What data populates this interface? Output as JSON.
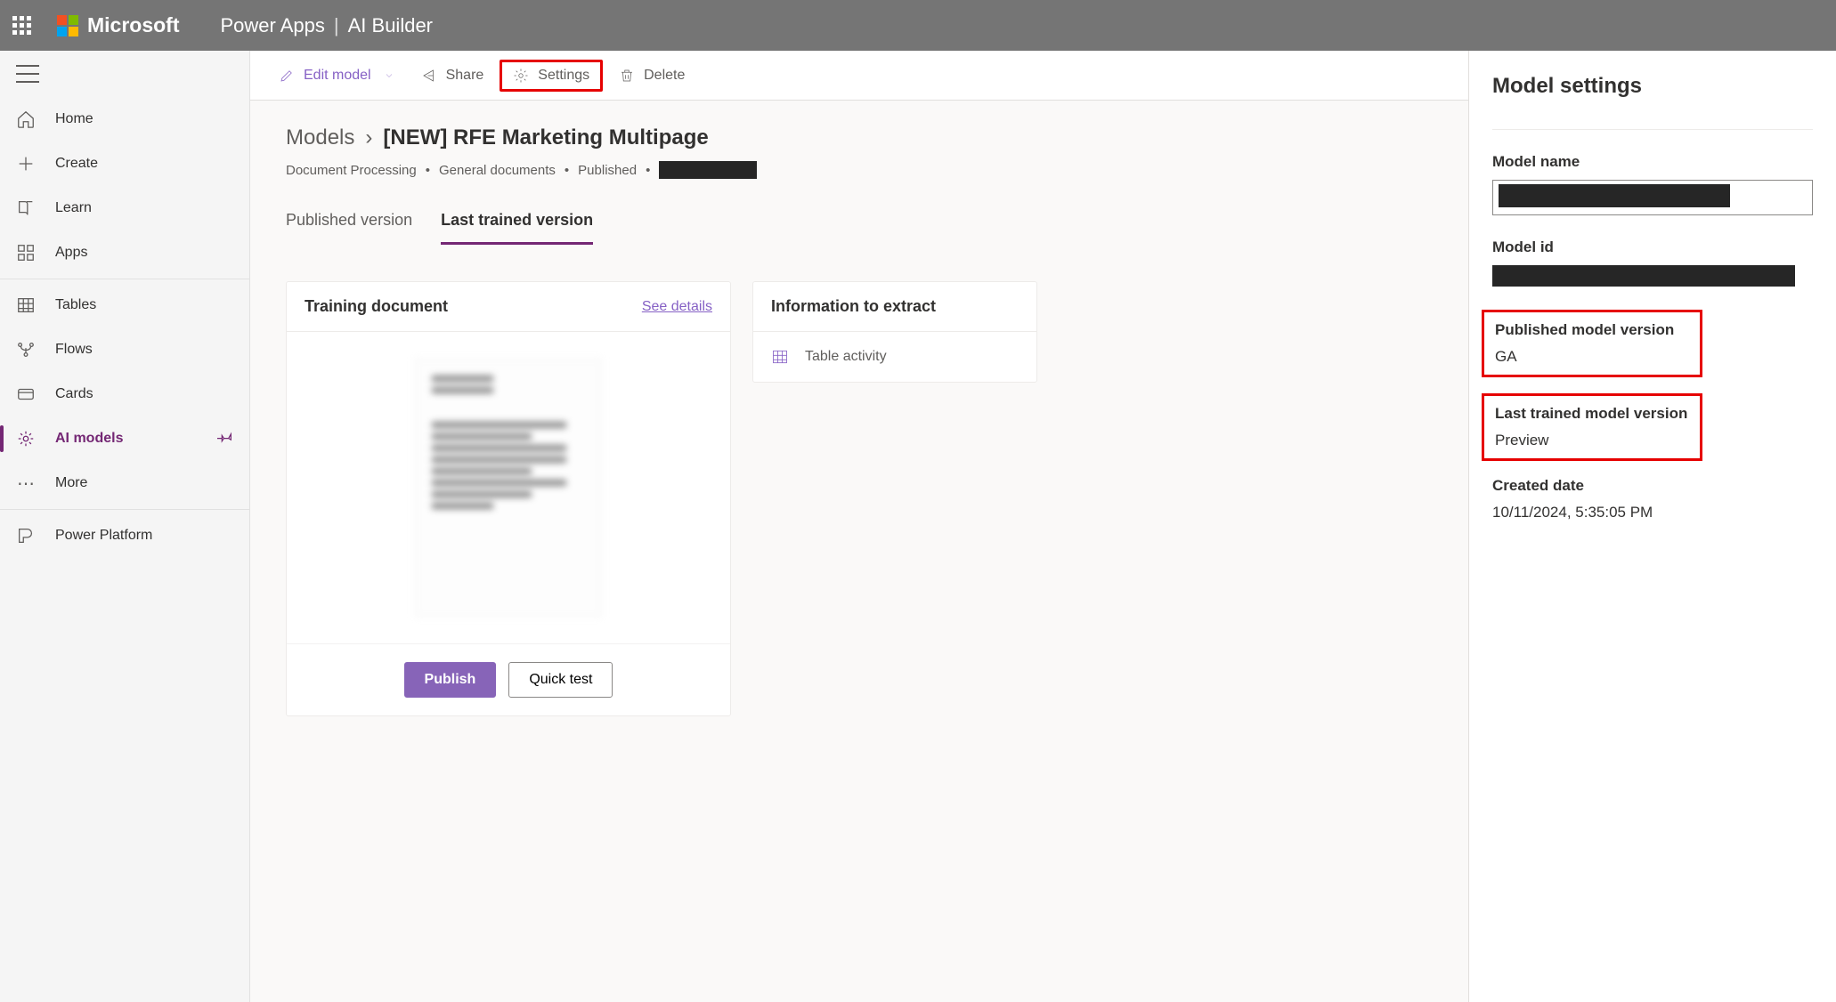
{
  "header": {
    "brand": "Microsoft",
    "app": "Power Apps",
    "section": "AI Builder"
  },
  "nav": {
    "home": "Home",
    "create": "Create",
    "learn": "Learn",
    "apps": "Apps",
    "tables": "Tables",
    "flows": "Flows",
    "cards": "Cards",
    "ai_models": "AI models",
    "more": "More",
    "power_platform": "Power Platform"
  },
  "commands": {
    "edit_model": "Edit model",
    "share": "Share",
    "settings": "Settings",
    "delete": "Delete"
  },
  "breadcrumb": {
    "root": "Models",
    "current": "[NEW] RFE Marketing Multipage"
  },
  "meta": {
    "type": "Document Processing",
    "subtype": "General documents",
    "status": "Published"
  },
  "tabs": {
    "published": "Published version",
    "trained": "Last trained version"
  },
  "training_card": {
    "title": "Training document",
    "see_details": "See details",
    "publish_btn": "Publish",
    "quick_test_btn": "Quick test"
  },
  "info_card": {
    "title": "Information to extract",
    "table_activity": "Table activity"
  },
  "settings_panel": {
    "title": "Model settings",
    "model_name_label": "Model name",
    "model_id_label": "Model id",
    "published_version_label": "Published model version",
    "published_version_value": "GA",
    "last_trained_label": "Last trained model version",
    "last_trained_value": "Preview",
    "created_date_label": "Created date",
    "created_date_value": "10/11/2024, 5:35:05 PM"
  }
}
